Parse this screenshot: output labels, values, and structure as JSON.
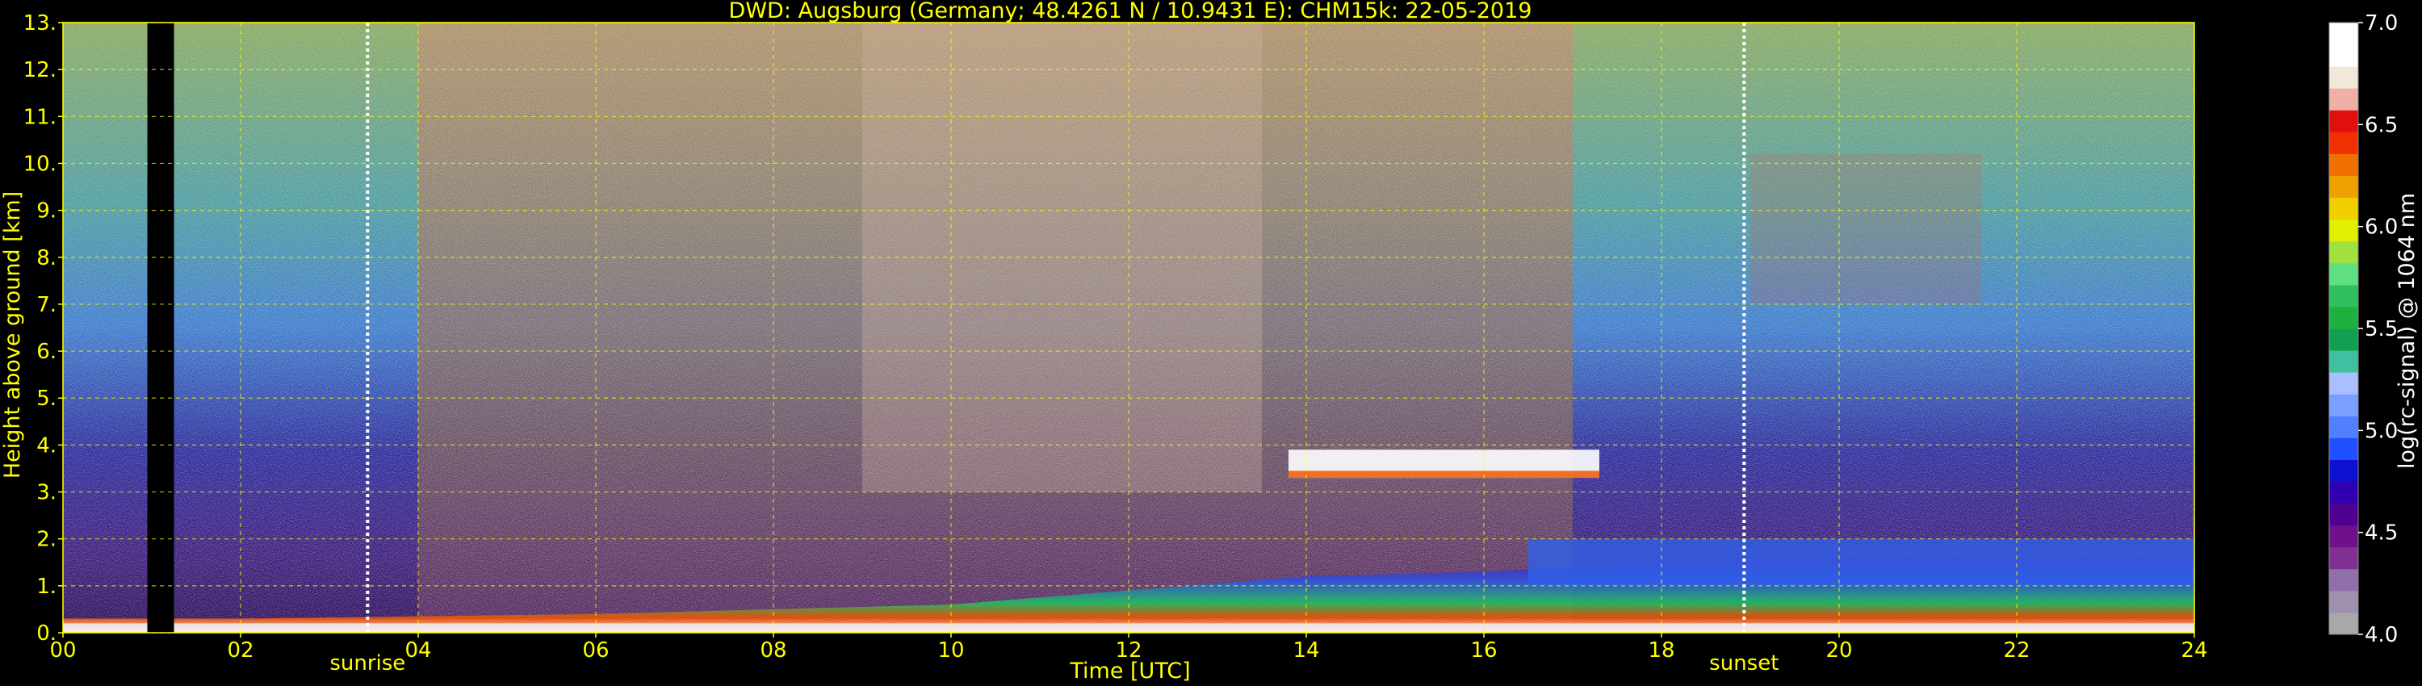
{
  "chart_data": {
    "type": "heatmap",
    "title": "DWD: Augsburg (Germany; 48.4261 N / 10.9431 E):    CHM15k: 22-05-2019",
    "xlabel": "Time [UTC]",
    "ylabel": "Height above ground [km]",
    "xlim": [
      0,
      24
    ],
    "ylim": [
      0,
      13
    ],
    "x_ticks": [
      "00",
      "02",
      "04",
      "06",
      "08",
      "10",
      "12",
      "14",
      "16",
      "18",
      "20",
      "22",
      "24"
    ],
    "y_ticks": [
      "0.",
      "1.",
      "2.",
      "3.",
      "4.",
      "5.",
      "6.",
      "7.",
      "8.",
      "9.",
      "10.",
      "11.",
      "12.",
      "13."
    ],
    "grid": true,
    "events": [
      {
        "label": "sunrise",
        "time": 3.43
      },
      {
        "label": "sunset",
        "time": 18.93
      }
    ],
    "colorbar": {
      "label": "log(rc-signal) @ 1064 nm",
      "range": [
        4.0,
        7.0
      ],
      "ticks": [
        "4.0",
        "4.5",
        "5.0",
        "5.5",
        "6.0",
        "6.5",
        "7.0"
      ],
      "colors": [
        "#a8a8a8",
        "#a090b0",
        "#9070a8",
        "#803090",
        "#70108a",
        "#500090",
        "#3000b0",
        "#1010d0",
        "#2050ff",
        "#5080ff",
        "#7aa0ff",
        "#a8c0ff",
        "#40c0a0",
        "#10a050",
        "#20b040",
        "#30c060",
        "#60e080",
        "#a0e040",
        "#e0f000",
        "#f0d000",
        "#f0a000",
        "#f07000",
        "#f03000",
        "#e01010",
        "#f0b0a8",
        "#f0e8d8",
        "#ffffff",
        "#ffffff"
      ]
    },
    "data_gap": {
      "start": 0.95,
      "end": 1.25
    },
    "features": [
      {
        "name": "boundary layer aerosol",
        "x": [
          0,
          2,
          4,
          6,
          8,
          10,
          12,
          14,
          16,
          17,
          18,
          20,
          22,
          24
        ],
        "top": [
          0.3,
          0.3,
          0.35,
          0.4,
          0.5,
          0.6,
          0.9,
          1.2,
          1.3,
          1.4,
          1.5,
          1.6,
          1.6,
          1.6
        ]
      },
      {
        "name": "mid-level cloud",
        "x": [
          13.8,
          17.3
        ],
        "base": 3.3,
        "top": 3.9
      },
      {
        "name": "cirrus",
        "x": [
          19.0,
          21.6
        ],
        "base": 7.0,
        "top": 10.2
      },
      {
        "name": "residual layer",
        "x": [
          16.5,
          24
        ],
        "base": 1.0,
        "top": 2.0
      }
    ]
  }
}
